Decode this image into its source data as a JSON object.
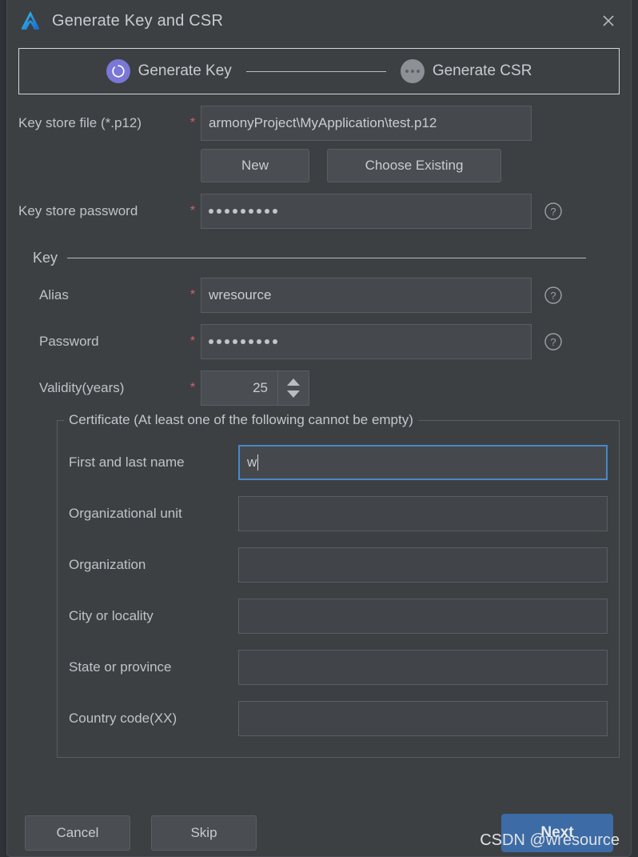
{
  "window": {
    "title": "Generate Key and CSR",
    "app_icon": "deveco-logo-icon",
    "close_icon": "close-icon"
  },
  "stepper": {
    "steps": [
      {
        "label": "Generate Key",
        "state": "active",
        "icon": "step-active-ring-icon"
      },
      {
        "label": "Generate CSR",
        "state": "inactive",
        "icon": "step-pending-dots-icon"
      }
    ]
  },
  "keystore": {
    "file_label": "Key store file (*.p12)",
    "file_required": "*",
    "file_value": "armonyProject\\MyApplication\\test.p12",
    "new_button": "New",
    "choose_existing_button": "Choose Existing",
    "password_label": "Key store password",
    "password_required": "*",
    "password_value": "•••••••••",
    "password_help_icon": "help-circle-icon"
  },
  "key_group": {
    "title": "Key",
    "alias_label": "Alias",
    "alias_required": "*",
    "alias_value": "wresource",
    "alias_help_icon": "help-circle-icon",
    "password_label": "Password",
    "password_required": "*",
    "password_value": "•••••••••",
    "password_help_icon": "help-circle-icon",
    "validity_label": "Validity(years)",
    "validity_required": "*",
    "validity_value": "25"
  },
  "certificate": {
    "legend": "Certificate (At least one of the following cannot be empty)",
    "fields": [
      {
        "label": "First and last name",
        "value": "w",
        "focused": true
      },
      {
        "label": "Organizational unit",
        "value": "",
        "focused": false
      },
      {
        "label": "Organization",
        "value": "",
        "focused": false
      },
      {
        "label": "City or locality",
        "value": "",
        "focused": false
      },
      {
        "label": "State or province",
        "value": "",
        "focused": false
      },
      {
        "label": "Country code(XX)",
        "value": "",
        "focused": false
      }
    ]
  },
  "footer": {
    "cancel": "Cancel",
    "skip": "Skip",
    "next": "Next"
  },
  "watermark": "CSDN @wresource",
  "colors": {
    "dialog_bg": "#3c4043",
    "accent_step": "#7b77d6",
    "focus_border": "#4a88c7",
    "primary_button": "#3c6ba5",
    "required_star": "#d4626a"
  }
}
